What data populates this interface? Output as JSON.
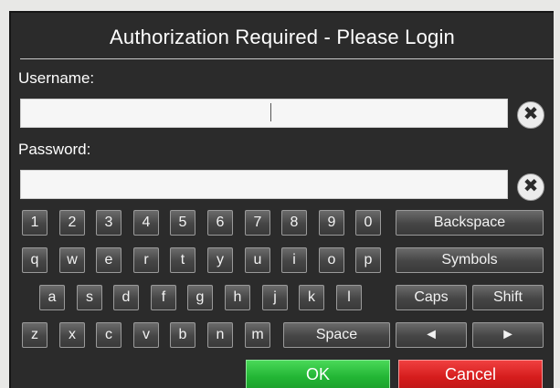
{
  "dialog": {
    "title": "Authorization Required - Please Login"
  },
  "form": {
    "username_label": "Username:",
    "username_value": "",
    "password_label": "Password:",
    "password_value": "",
    "clear_glyph": "✖"
  },
  "keyboard": {
    "row1": [
      "1",
      "2",
      "3",
      "4",
      "5",
      "6",
      "7",
      "8",
      "9",
      "0"
    ],
    "row2": [
      "q",
      "w",
      "e",
      "r",
      "t",
      "y",
      "u",
      "i",
      "o",
      "p"
    ],
    "row3": [
      "a",
      "s",
      "d",
      "f",
      "g",
      "h",
      "j",
      "k",
      "l"
    ],
    "row4": [
      "z",
      "x",
      "c",
      "v",
      "b",
      "n",
      "m"
    ],
    "backspace": "Backspace",
    "symbols": "Symbols",
    "caps": "Caps",
    "shift": "Shift",
    "space": "Space",
    "left_arrow": "◄",
    "right_arrow": "►"
  },
  "actions": {
    "ok": "OK",
    "cancel": "Cancel"
  },
  "colors": {
    "panel": "#2b2b2b",
    "ok": "#22b534",
    "cancel": "#d51c1c"
  }
}
